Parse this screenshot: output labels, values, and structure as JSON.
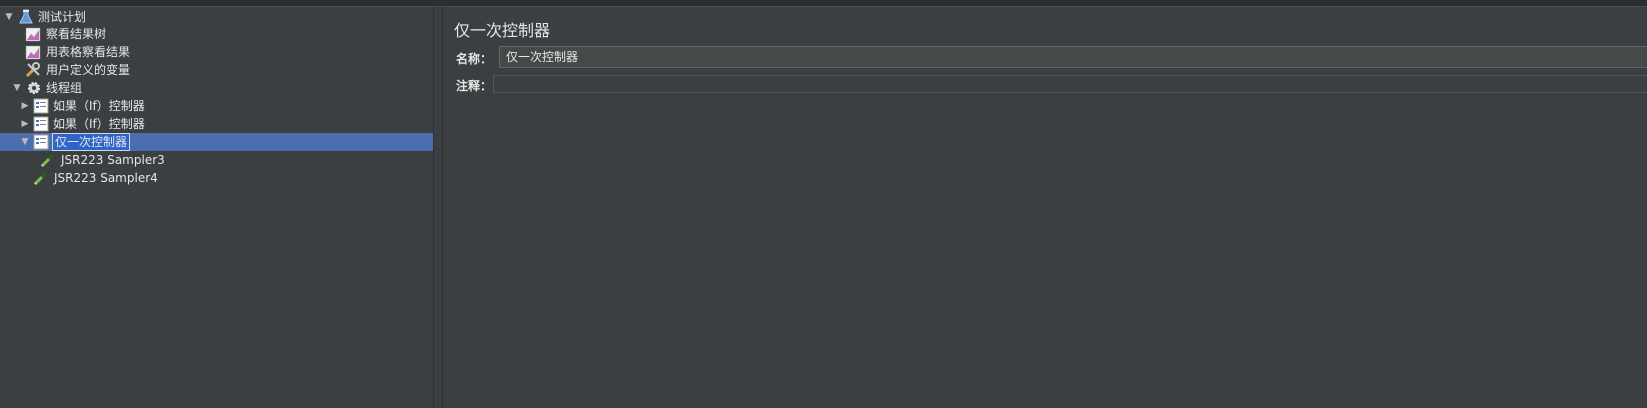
{
  "tree": {
    "items": [
      {
        "label": "测试计划",
        "expanded": true,
        "icon": "flask-icon"
      },
      {
        "label": "察看结果树",
        "icon": "chart-icon"
      },
      {
        "label": "用表格察看结果",
        "icon": "chart-icon"
      },
      {
        "label": "用户定义的变量",
        "icon": "wrench-icon"
      },
      {
        "label": "线程组",
        "expanded": true,
        "icon": "gear-icon"
      },
      {
        "label": "如果（If）控制器",
        "expanded": false,
        "icon": "controller-icon"
      },
      {
        "label": "如果（If）控制器",
        "expanded": false,
        "icon": "controller-icon"
      },
      {
        "label": "仅一次控制器",
        "expanded": true,
        "selected": true,
        "icon": "controller-icon"
      },
      {
        "label": "JSR223 Sampler3",
        "icon": "pipette-icon"
      },
      {
        "label": "JSR223 Sampler4",
        "icon": "pipette-icon"
      }
    ]
  },
  "panel": {
    "title": "仅一次控制器",
    "name_label": "名称：",
    "name_value": "仅一次控制器",
    "comment_label": "注释：",
    "comment_value": ""
  },
  "colors": {
    "background": "#3c3f41",
    "selection": "#4b6eaf",
    "text": "#e6e6e6"
  }
}
